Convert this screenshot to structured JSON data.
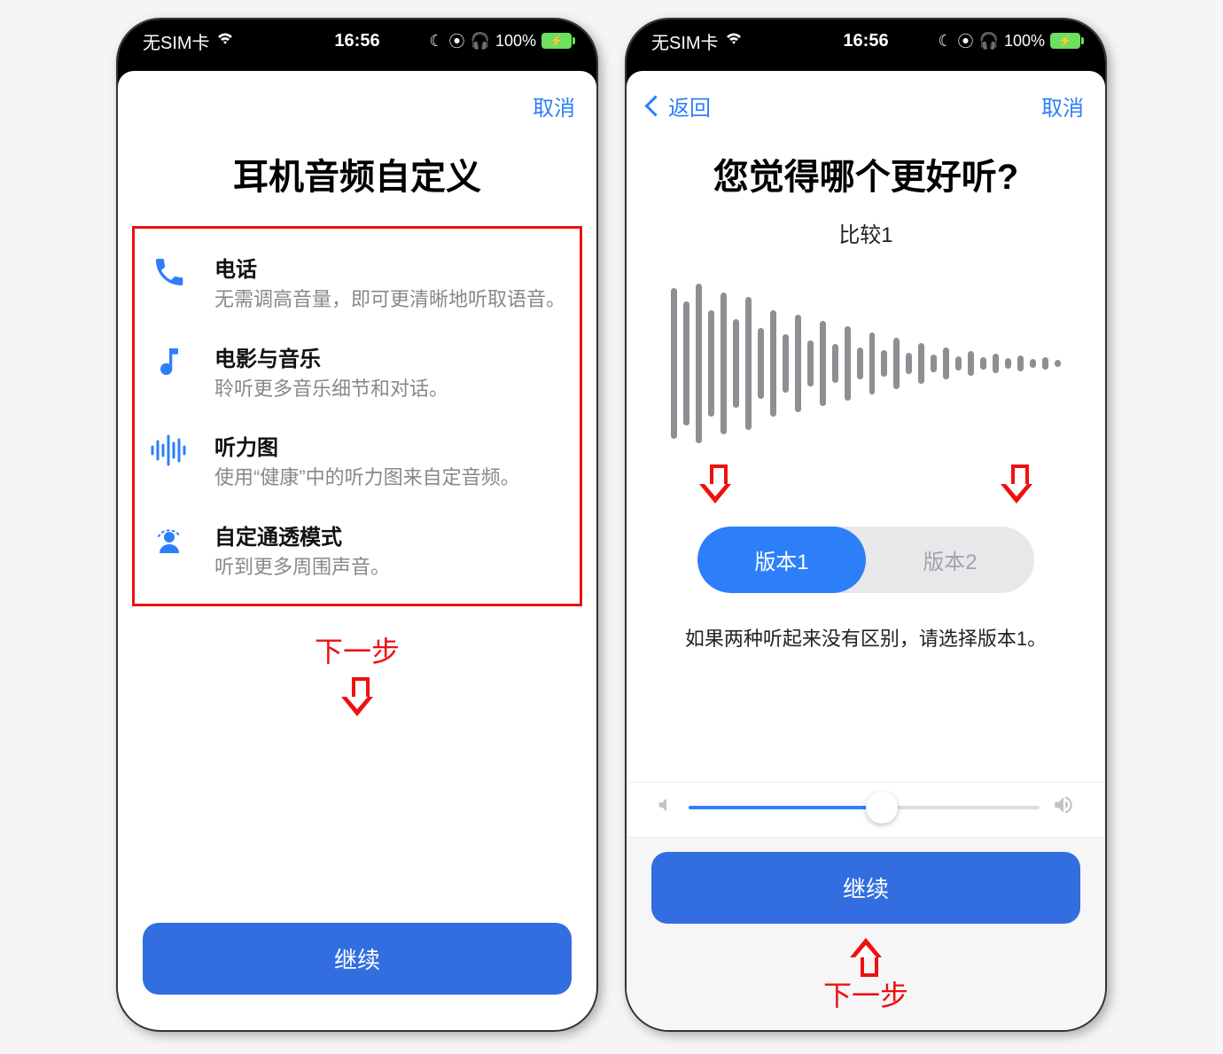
{
  "status": {
    "sim": "无SIM卡",
    "time": "16:56",
    "battery_pct": "100%",
    "icons": [
      "moon",
      "target",
      "headphones"
    ]
  },
  "colors": {
    "accent": "#2d7ff9",
    "annotation": "#e11"
  },
  "left": {
    "nav": {
      "cancel": "取消"
    },
    "title": "耳机音频自定义",
    "features": [
      {
        "icon": "phone-icon",
        "title": "电话",
        "desc": "无需调高音量，即可更清晰地听取语音。"
      },
      {
        "icon": "music-note-icon",
        "title": "电影与音乐",
        "desc": "聆听更多音乐细节和对话。"
      },
      {
        "icon": "waveform-icon",
        "title": "听力图",
        "desc": "使用“健康”中的听力图来自定音频。"
      },
      {
        "icon": "person-transparency-icon",
        "title": "自定通透模式",
        "desc": "听到更多周围声音。"
      }
    ],
    "annotation": "下一步",
    "primary": "继续"
  },
  "right": {
    "nav": {
      "back": "返回",
      "cancel": "取消"
    },
    "title": "您觉得哪个更好听?",
    "subtitle": "比较1",
    "waveform_bars": [
      170,
      140,
      180,
      120,
      160,
      100,
      150,
      80,
      120,
      66,
      110,
      52,
      96,
      44,
      84,
      36,
      70,
      30,
      58,
      24,
      46,
      20,
      36,
      16,
      28,
      14,
      22,
      12,
      18,
      10,
      14,
      8
    ],
    "segmented": {
      "option1": "版本1",
      "option2": "版本2",
      "active": 1
    },
    "hint": "如果两种听起来没有区别，请选择版本1。",
    "slider_value": 0.55,
    "primary": "继续",
    "annotation": "下一步"
  }
}
